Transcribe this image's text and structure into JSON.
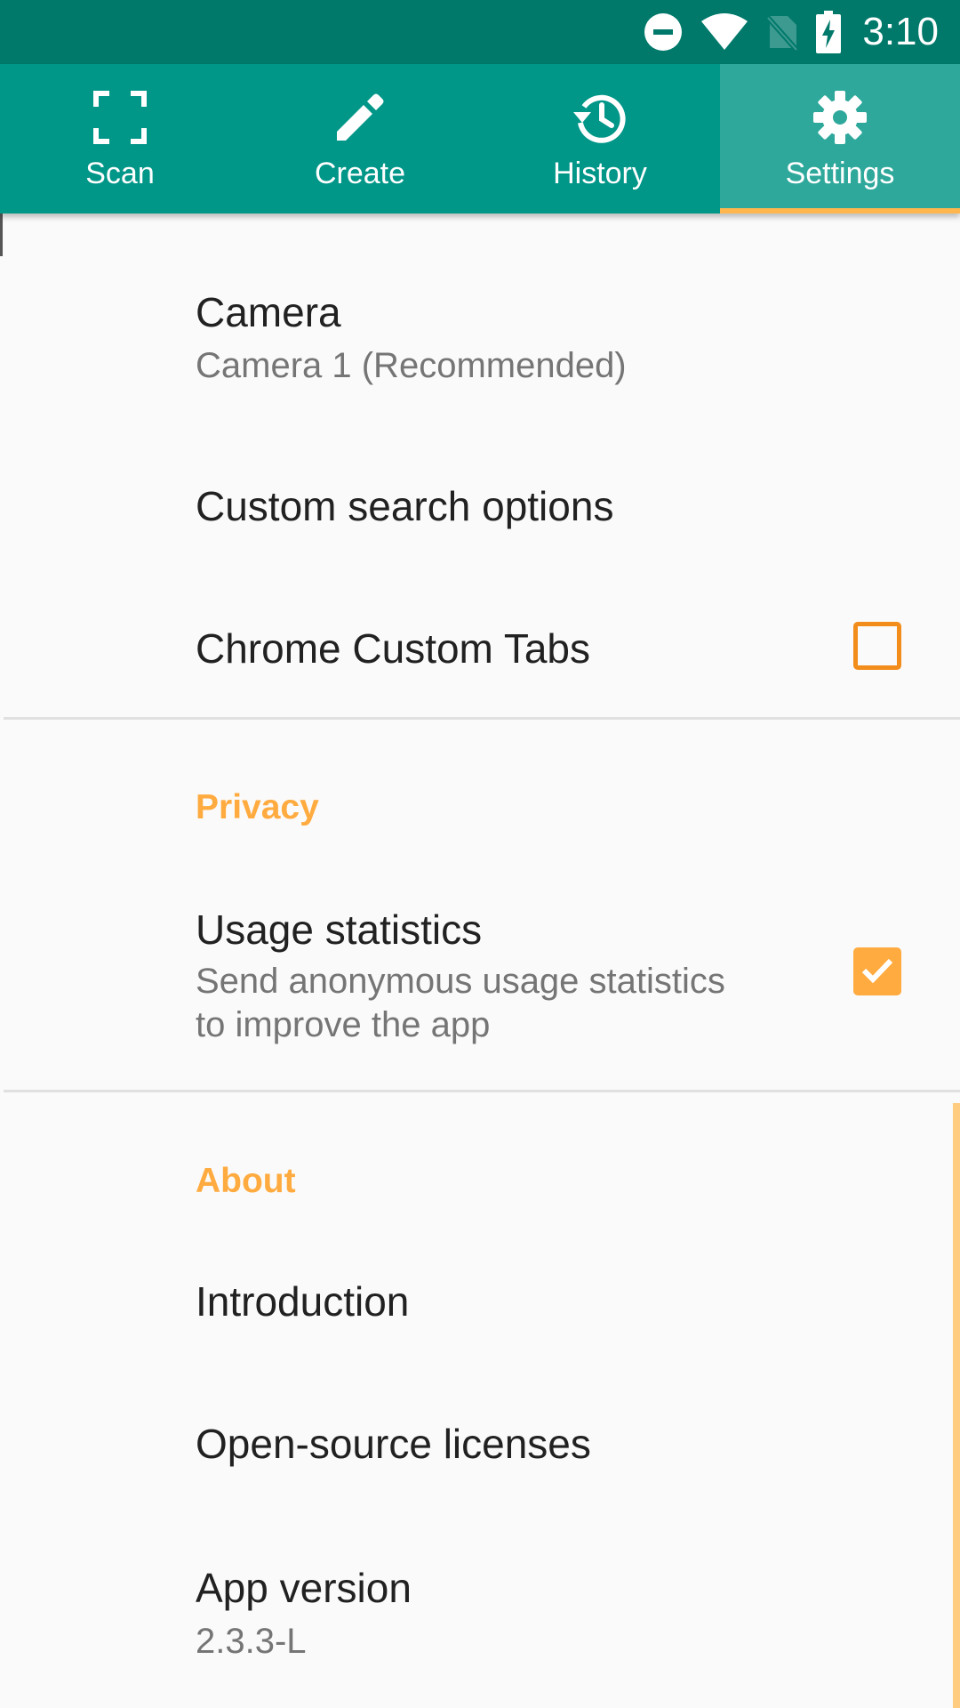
{
  "status_bar": {
    "time": "3:10",
    "icons": [
      "do-not-disturb-icon",
      "wifi-icon",
      "no-sim-icon",
      "battery-charging-icon"
    ]
  },
  "tabs": [
    {
      "label": "Scan",
      "icon": "scan-icon",
      "active": false
    },
    {
      "label": "Create",
      "icon": "pencil-icon",
      "active": false
    },
    {
      "label": "History",
      "icon": "history-icon",
      "active": false
    },
    {
      "label": "Settings",
      "icon": "gear-icon",
      "active": true
    }
  ],
  "settings": {
    "camera": {
      "title": "Camera",
      "summary": "Camera 1 (Recommended)"
    },
    "custom_search": {
      "title": "Custom search options"
    },
    "chrome_tabs": {
      "title": "Chrome Custom Tabs",
      "checked": false
    },
    "privacy": {
      "category": "Privacy",
      "usage": {
        "title": "Usage statistics",
        "summary_line1": "Send anonymous usage statistics",
        "summary_line2": "to improve the app",
        "checked": true
      }
    },
    "about": {
      "category": "About",
      "introduction": {
        "title": "Introduction"
      },
      "licenses": {
        "title": "Open-source licenses"
      },
      "version": {
        "title": "App version",
        "summary": "2.3.3-L"
      }
    }
  },
  "colors": {
    "status_bar": "#00796b",
    "toolbar": "#009688",
    "active_tab": "#2fa89c",
    "accent": "#ffab40",
    "tab_indicator": "#ffb74d"
  }
}
